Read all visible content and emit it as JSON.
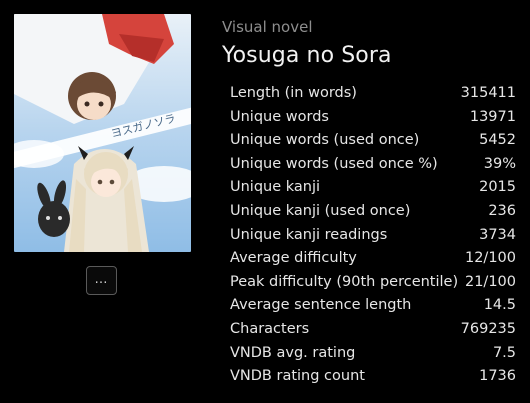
{
  "cover": {
    "alt": "Yosuga no Sora cover art",
    "logo_text": "ヨスガノソラ"
  },
  "more_button": {
    "label": "…"
  },
  "info": {
    "category": "Visual novel",
    "title": "Yosuga no Sora"
  },
  "stats": [
    {
      "label": "Length (in words)",
      "value": "315411"
    },
    {
      "label": "Unique words",
      "value": "13971"
    },
    {
      "label": "Unique words (used once)",
      "value": "5452"
    },
    {
      "label": "Unique words (used once %)",
      "value": "39%"
    },
    {
      "label": "Unique kanji",
      "value": "2015"
    },
    {
      "label": "Unique kanji (used once)",
      "value": "236"
    },
    {
      "label": "Unique kanji readings",
      "value": "3734"
    },
    {
      "label": "Average difficulty",
      "value": "12/100"
    },
    {
      "label": "Peak difficulty (90th percentile)",
      "value": "21/100"
    },
    {
      "label": "Average sentence length",
      "value": "14.5"
    },
    {
      "label": "Characters",
      "value": "769235"
    },
    {
      "label": "VNDB avg. rating",
      "value": "7.5"
    },
    {
      "label": "VNDB rating count",
      "value": "1736"
    }
  ],
  "colors": {
    "background": "#000000",
    "text": "#e6e6e6",
    "muted": "#8e8e8e",
    "sky": "#a9cbe8"
  }
}
